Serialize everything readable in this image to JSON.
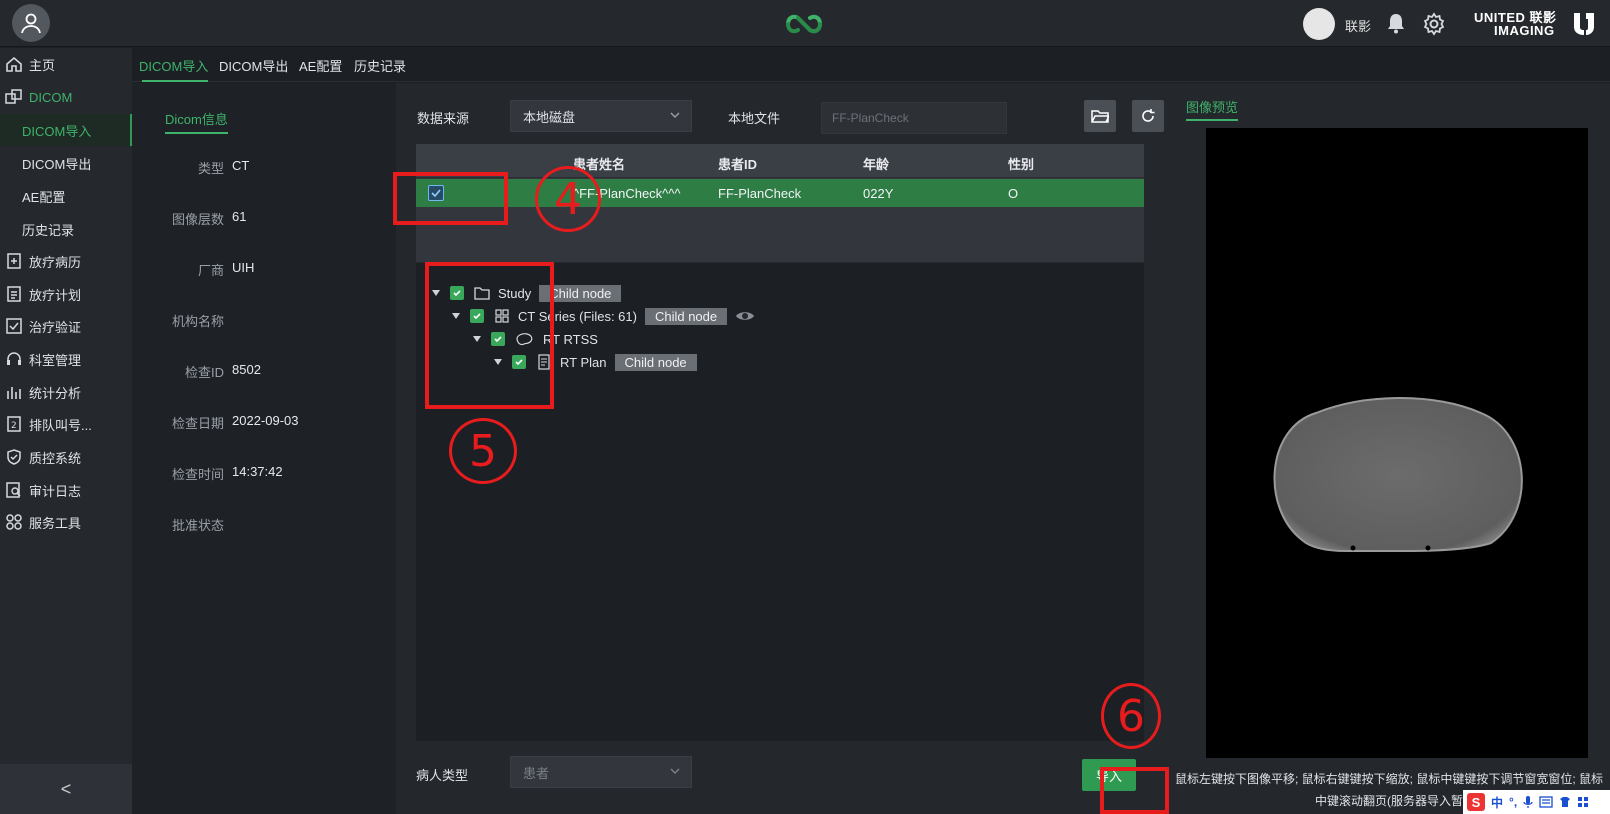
{
  "topbar": {
    "username": "联影",
    "brand_line1": "UNITED 联影",
    "brand_line2": "IMAGING"
  },
  "sidebar": {
    "items": [
      {
        "label": "主页",
        "icon": "home-icon"
      },
      {
        "label": "DICOM",
        "icon": "dicom-icon"
      },
      {
        "label": "DICOM导入"
      },
      {
        "label": "DICOM导出"
      },
      {
        "label": "AE配置"
      },
      {
        "label": "历史记录"
      },
      {
        "label": "放疗病历",
        "icon": "medical-record-icon"
      },
      {
        "label": "放疗计划",
        "icon": "plan-icon"
      },
      {
        "label": "治疗验证",
        "icon": "verify-icon"
      },
      {
        "label": "科室管理",
        "icon": "headset-icon"
      },
      {
        "label": "统计分析",
        "icon": "chart-icon"
      },
      {
        "label": "排队叫号...",
        "icon": "queue-icon"
      },
      {
        "label": "质控系统",
        "icon": "shield-icon"
      },
      {
        "label": "审计日志",
        "icon": "audit-icon"
      },
      {
        "label": "服务工具",
        "icon": "tools-icon"
      }
    ],
    "collapse_glyph": "<"
  },
  "tabs": [
    "DICOM导入",
    "DICOM导出",
    "AE配置",
    "历史记录"
  ],
  "info": {
    "header": "Dicom信息",
    "rows": [
      {
        "k": "类型",
        "v": "CT"
      },
      {
        "k": "图像层数",
        "v": "61"
      },
      {
        "k": "厂商",
        "v": "UIH"
      },
      {
        "k": "机构名称",
        "v": ""
      },
      {
        "k": "检查ID",
        "v": "8502"
      },
      {
        "k": "检查日期",
        "v": "2022-09-03"
      },
      {
        "k": "检查时间",
        "v": "14:37:42"
      },
      {
        "k": "批准状态",
        "v": ""
      }
    ]
  },
  "source": {
    "label": "数据来源",
    "value": "本地磁盘",
    "file_label": "本地文件",
    "file_placeholder": "FF-PlanCheck"
  },
  "table": {
    "headers": [
      "患者姓名",
      "患者ID",
      "年龄",
      "性别"
    ],
    "rows": [
      {
        "name": "^FF-PlanCheck^^^",
        "id": "FF-PlanCheck",
        "age": "022Y",
        "sex": "O"
      }
    ]
  },
  "tree": {
    "nodes": [
      {
        "label": "Study",
        "tag": "Child node"
      },
      {
        "label": "CT Series (Files: 61)",
        "tag": "Child node"
      },
      {
        "label": "RT RTSS",
        "tag": ""
      },
      {
        "label": "RT Plan",
        "tag": "Child node"
      }
    ]
  },
  "patient_type": {
    "label": "病人类型",
    "placeholder": "患者"
  },
  "import_label": "导入",
  "preview": {
    "header": "图像预览",
    "tip": "鼠标左键按下图像平移; 鼠标右键键按下缩放; 鼠标中键键按下调节窗宽窗位; 鼠标中键滚动翻页(服务器导入暂"
  },
  "ime": {
    "logo": "S",
    "mode": "中"
  },
  "annotations": [
    "4",
    "5",
    "6"
  ],
  "colors": {
    "accent": "#3fb36a",
    "selected_row": "#2e7d45",
    "annotation": "#e81c1c"
  }
}
